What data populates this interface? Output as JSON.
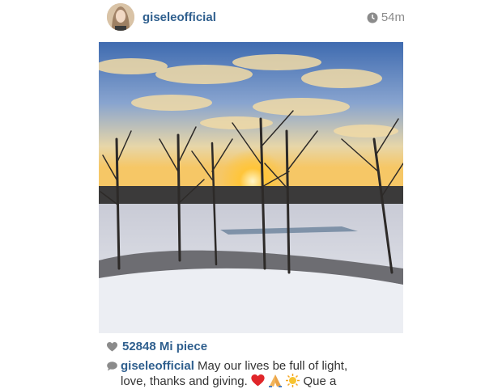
{
  "post": {
    "username": "giseleofficial",
    "time": "54m",
    "likes": "52848 Mi piece",
    "caption_user": "giseleofficial",
    "caption_line1": "May our lives be full of light,",
    "caption_line2": "love, thanks and giving.",
    "caption_emojis": [
      "heart",
      "praying-hands",
      "sun"
    ],
    "caption_tail": "Que a"
  },
  "colors": {
    "link": "#2f5f8e",
    "muted": "#8b8b8b",
    "heart": "#e0262a"
  }
}
